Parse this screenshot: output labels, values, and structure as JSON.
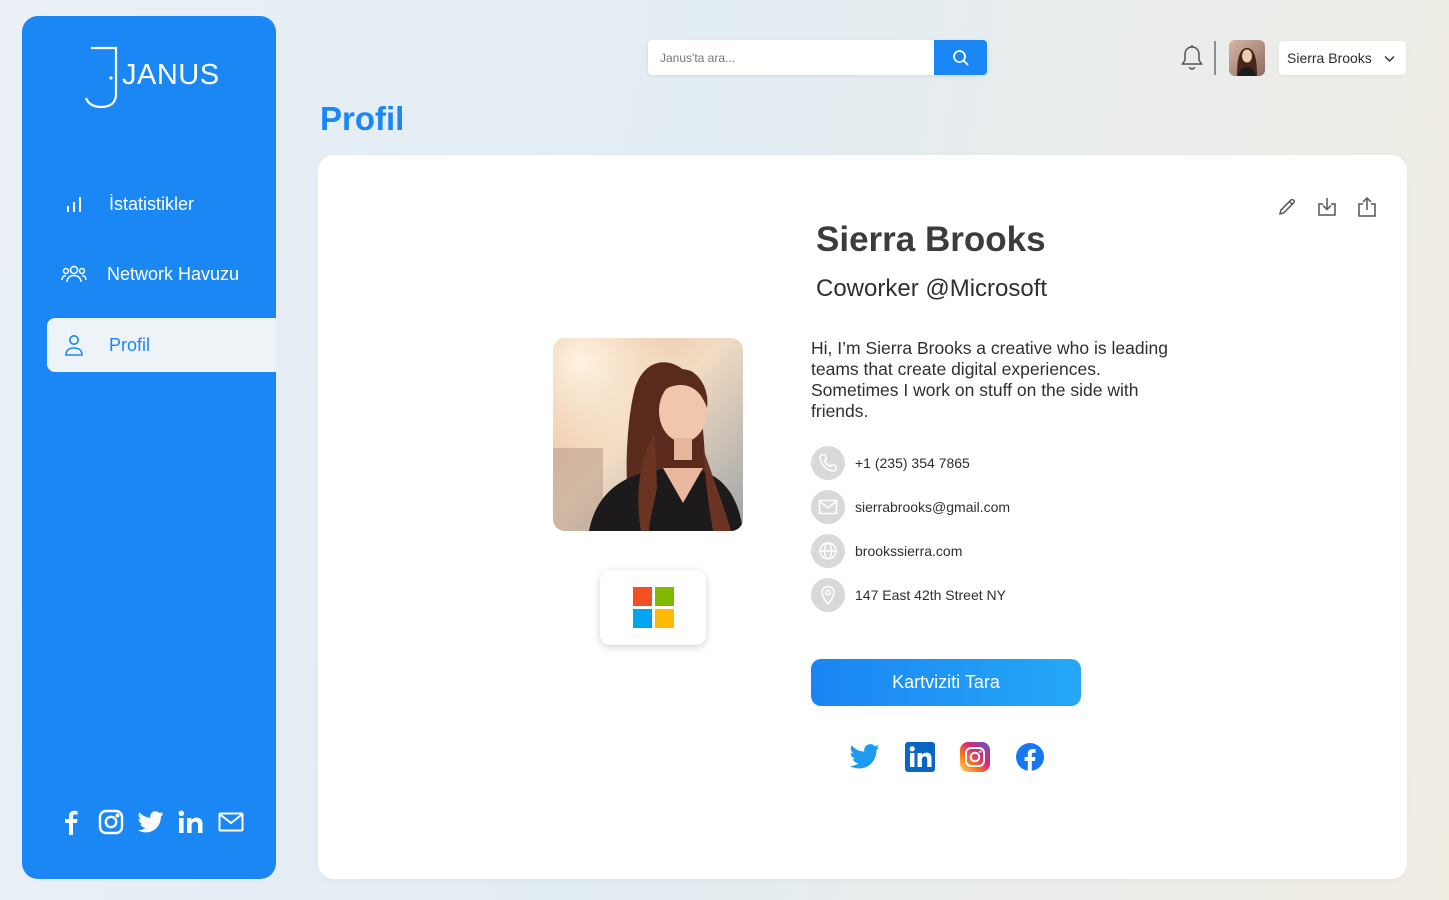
{
  "brand": {
    "name": "JANUS"
  },
  "sidebar": {
    "items": [
      {
        "label": "İstatistikler",
        "icon": "bar-chart-icon"
      },
      {
        "label": "Network Havuzu",
        "icon": "users-icon"
      },
      {
        "label": "Profil",
        "icon": "user-icon",
        "active": true
      }
    ],
    "social": [
      "facebook-icon",
      "instagram-icon",
      "twitter-icon",
      "linkedin-icon",
      "mail-icon"
    ]
  },
  "search": {
    "placeholder": "Janus'ta ara..."
  },
  "header": {
    "user_name": "Sierra Brooks"
  },
  "page": {
    "title": "Profil"
  },
  "profile": {
    "name": "Sierra Brooks",
    "job": "Coworker @Microsoft",
    "bio": "Hi, I’m Sierra Brooks a creative who is leading teams that create digital experiences. Sometimes I work on stuff on the side with friends.",
    "contacts": [
      {
        "icon": "phone-icon",
        "value": "+1 (235) 354 7865"
      },
      {
        "icon": "mail-icon",
        "value": "sierrabrooks@gmail.com"
      },
      {
        "icon": "globe-icon",
        "value": "brookssierra.com"
      },
      {
        "icon": "location-icon",
        "value": "147 East 42th Street NY"
      }
    ],
    "scan_button": "Kartviziti Tara"
  },
  "colors": {
    "primary": "#1a87f5",
    "ms_red": "#f25022",
    "ms_green": "#7fba00",
    "ms_blue": "#00a4ef",
    "ms_yellow": "#ffb900"
  }
}
